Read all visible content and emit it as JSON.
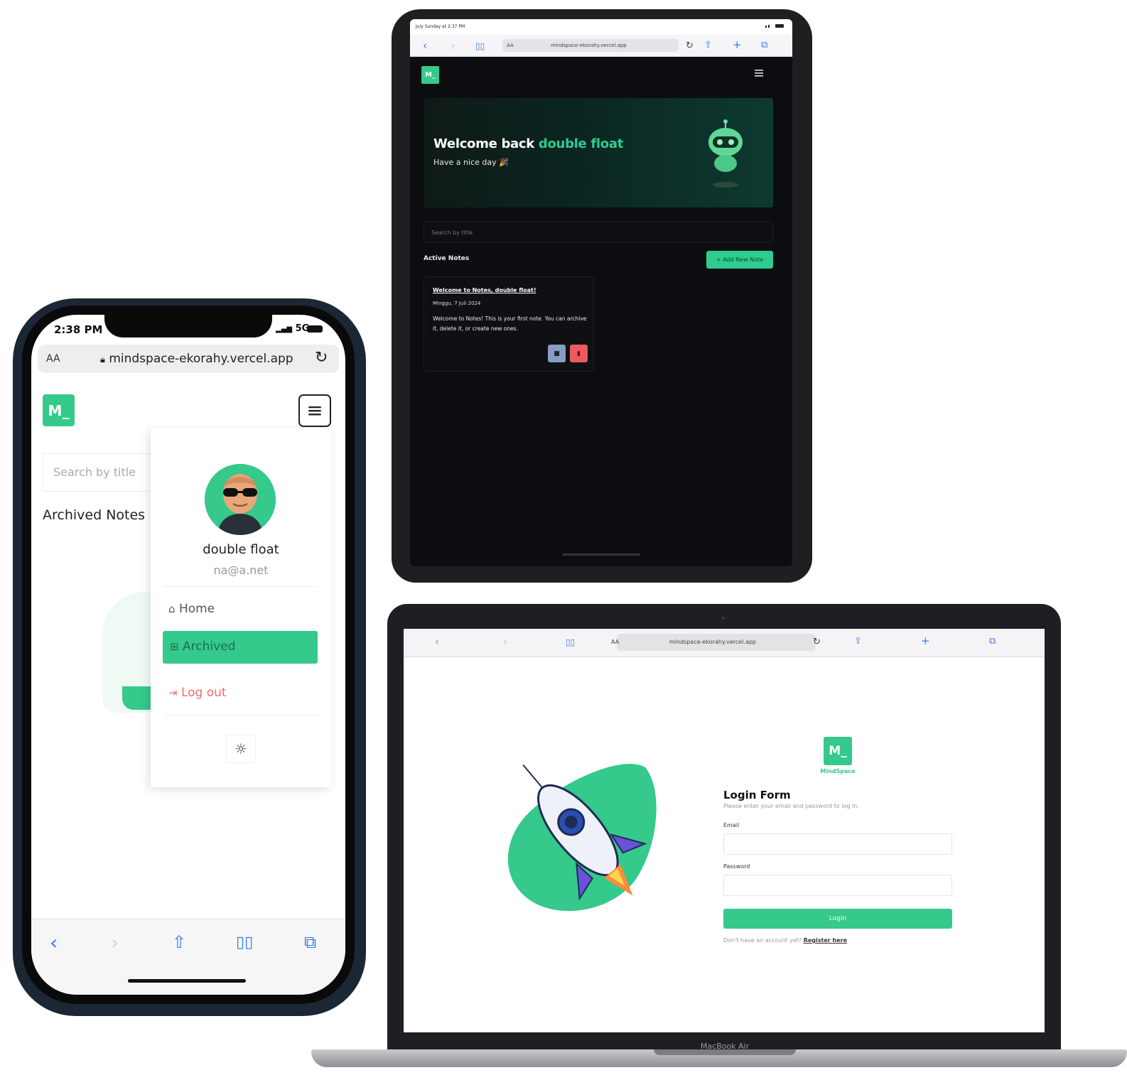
{
  "colors": {
    "accent": "#35c98b",
    "danger": "#ec5a5e",
    "dark_bg": "#0c0d10"
  },
  "tablet": {
    "status_left": "July Sunday at 2:37 PM",
    "url_aa": "AA",
    "url": "mindspace-ekorahy.vercel.app",
    "logo": "M_",
    "hero_title_prefix": "Welcome back",
    "hero_title_name": "double float",
    "hero_subtitle": "Have a nice day 🎉",
    "search_placeholder": "Search by title",
    "section_title": "Active Notes",
    "add_button": "+ Add New Note",
    "note": {
      "title": "Welcome to Notes, double float!",
      "date": "Minggu, 7 Juli 2024",
      "body": "Welcome to Notes! This is your first note. You can archive it, delete it, or create new ones."
    }
  },
  "phone": {
    "time": "2:38 PM",
    "network": "5G",
    "url_aa": "AA",
    "url": "mindspace-ekorahy.vercel.app",
    "logo": "M_",
    "search_placeholder": "Search by title",
    "page_title": "Archived Notes",
    "drawer": {
      "name": "double float",
      "email": "na@a.net",
      "items": [
        {
          "label": "Home",
          "icon": "home-icon"
        },
        {
          "label": "Archived",
          "icon": "archive-icon"
        },
        {
          "label": "Log out",
          "icon": "logout-icon"
        }
      ]
    }
  },
  "laptop": {
    "url_aa": "AA",
    "url": "mindspace-ekorahy.vercel.app",
    "logo": "M_",
    "app_name": "MindSpace",
    "form_title": "Login Form",
    "form_subtitle": "Please enter your email and password to log in.",
    "email_label": "Email",
    "password_label": "Password",
    "login_button": "Login",
    "register_prompt": "Don't have an account yet?",
    "register_link": "Register here",
    "device_label": "MacBook Air"
  }
}
